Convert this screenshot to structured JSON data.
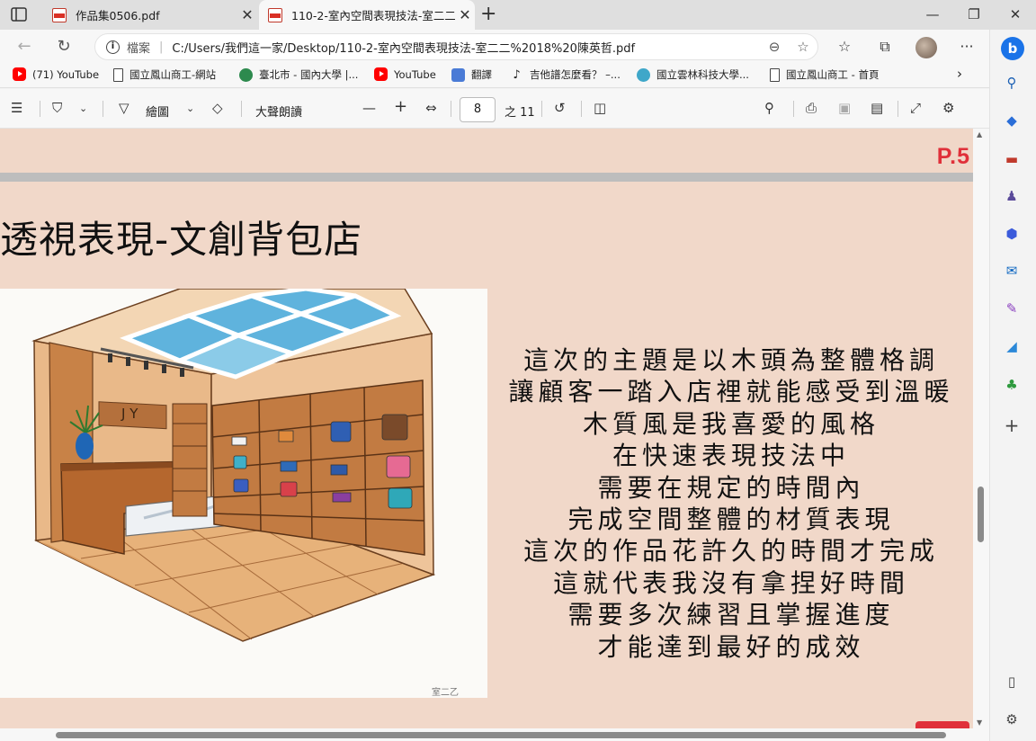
{
  "tabs": [
    {
      "title": "作品集0506.pdf",
      "close": "✕"
    },
    {
      "title": "110-2-室內空間表現技法-室二二",
      "close": "✕"
    }
  ],
  "new_tab": "+",
  "window_controls": {
    "minimize": "—",
    "restore": "❐",
    "close": "✕"
  },
  "address": {
    "label": "檔案",
    "url": "C:/Users/我們這一家/Desktop/110-2-室內空間表現技法-室二二%2018%20陳英哲.pdf"
  },
  "bookmarks": [
    {
      "label": "(71) YouTube",
      "icon": "youtube-icon"
    },
    {
      "label": "國立鳳山商工-網站",
      "icon": "page-icon"
    },
    {
      "label": "臺北市 - 國內大學 |...",
      "icon": "globe-icon"
    },
    {
      "label": "YouTube",
      "icon": "youtube-icon"
    },
    {
      "label": "翻譯",
      "icon": "translate-icon"
    },
    {
      "label": "吉他譜怎麼看？ –...",
      "icon": "guitar-icon"
    },
    {
      "label": "國立雲林科技大學...",
      "icon": "yuntech-icon"
    },
    {
      "label": "國立鳳山商工 - 首頁",
      "icon": "page-icon"
    }
  ],
  "pdf_toolbar": {
    "draw_label": "繪圖",
    "read_aloud_label": "大聲朗讀",
    "current_page": "8",
    "total_pages": "之 11"
  },
  "document": {
    "prev_page_number": "P.5",
    "heading": "透視表現-文創背包店",
    "illustration_sign": "J Y",
    "body_lines": [
      "這次的主題是以木頭為整體格調",
      "讓顧客一踏入店裡就能感受到溫暖",
      "木質風是我喜愛的風格",
      "在快速表現技法中",
      "需要在規定的時間內",
      "完成空間整體的材質表現",
      "這次的作品花許久的時間才完成",
      "這就代表我沒有拿捏好時間",
      "需要多次練習且掌握進度",
      "才能達到最好的成效"
    ]
  },
  "colors": {
    "page_background": "#f1d8c9",
    "page_number_red": "#e0303a",
    "wood": "#c98a4f"
  }
}
